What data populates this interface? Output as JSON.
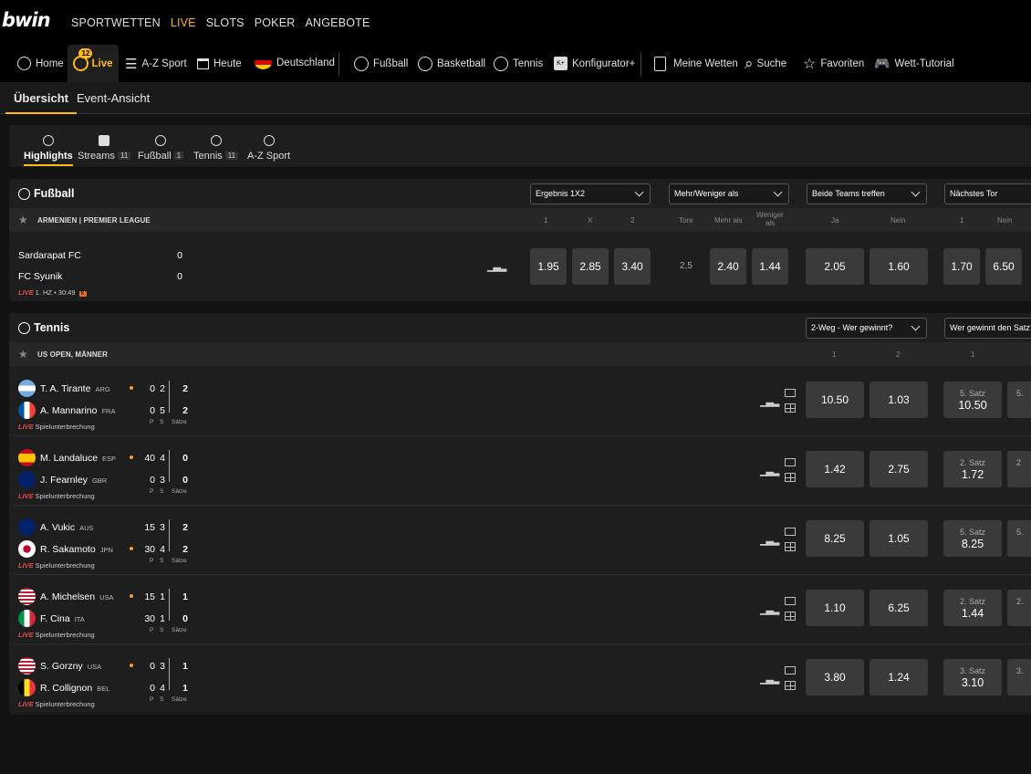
{
  "brand": "bwin",
  "topnav": [
    "SPORTWETTEN",
    "LIVE",
    "SLOTS",
    "POKER",
    "ANGEBOTE"
  ],
  "nav2": {
    "home": "Home",
    "live_count": "12",
    "live": "Live",
    "az": "A-Z Sport",
    "heute": "Heute",
    "land": "Deutschland",
    "fussball": "Fußball",
    "basketball": "Basketball",
    "tennis": "Tennis",
    "konf_icon": "K+",
    "konfigurator": "Konfigurator+",
    "meine": "Meine Wetten",
    "suche": "Suche",
    "favoriten": "Favoriten",
    "tutorial": "Wett-Tutorial"
  },
  "tabs": {
    "overview": "Übersicht",
    "event": "Event-Ansicht"
  },
  "chips": [
    {
      "label": "Highlights",
      "count": ""
    },
    {
      "label": "Streams",
      "count": "11"
    },
    {
      "label": "Fußball",
      "count": "1"
    },
    {
      "label": "Tennis",
      "count": "11"
    },
    {
      "label": "A-Z Sport",
      "count": ""
    }
  ],
  "football": {
    "title": "Fußball",
    "dropdowns": [
      "Ergebnis 1X2",
      "Mehr/Weniger als",
      "Beide Teams treffen",
      "Nächstes Tor"
    ],
    "league": "ARMENIEN | PREMIER LEAGUE",
    "cols": {
      "c1": "1",
      "cx": "X",
      "c2": "2",
      "tore": "Tore",
      "mehr": "Mehr als",
      "weniger": "Weniger als",
      "ja": "Ja",
      "nein": "Nein",
      "n1": "1",
      "nnein": "Nein"
    },
    "home": "Sardarapat FC",
    "home_score": "0",
    "away": "FC Syunik",
    "away_score": "0",
    "live": "LIVE",
    "status": "1. HZ • 30:49",
    "card": "K",
    "stat_icon": "bar-chart",
    "odds": {
      "o1": "1.95",
      "ox": "2.85",
      "o2": "3.40",
      "tore": "2,5",
      "mehr": "2.40",
      "weniger": "1.44",
      "ja": "2.05",
      "nein": "1.60",
      "n1": "1.70",
      "nn": "6.50"
    }
  },
  "tennis": {
    "title": "Tennis",
    "dropdowns": [
      "2-Weg - Wer gewinnt?",
      "Wer gewinnt den Satz?"
    ],
    "league": "US OPEN, MÄNNER",
    "cols": {
      "c1": "1",
      "c2": "2",
      "s1": "1"
    },
    "labels": {
      "p": "P",
      "s": "S",
      "saetze": "Sätze",
      "live": "LIVE"
    },
    "matches": [
      {
        "p1": "T. A. Tirante",
        "c1": "ARG",
        "p2": "A. Mannarino",
        "c2": "FRA",
        "serve": 1,
        "pt1": "0",
        "g1": "2",
        "s1": "2",
        "pt2": "0",
        "g2": "5",
        "s2": "2",
        "status": "Spielunterbrechung",
        "o1": "10.50",
        "o2": "1.03",
        "set_label": "5. Satz",
        "set_odd": "10.50",
        "cut": "5."
      },
      {
        "p1": "M. Landaluce",
        "c1": "ESP",
        "p2": "J. Fearnley",
        "c2": "GBR",
        "serve": 1,
        "pt1": "40",
        "g1": "4",
        "s1": "0",
        "pt2": "0",
        "g2": "3",
        "s2": "0",
        "status": "Spielunterbrechung",
        "o1": "1.42",
        "o2": "2.75",
        "set_label": "2. Satz",
        "set_odd": "1.72",
        "cut": "2"
      },
      {
        "p1": "A. Vukic",
        "c1": "AUS",
        "p2": "R. Sakamoto",
        "c2": "JPN",
        "serve": 2,
        "pt1": "15",
        "g1": "3",
        "s1": "2",
        "pt2": "30",
        "g2": "4",
        "s2": "2",
        "status": "Spielunterbrechung",
        "o1": "8.25",
        "o2": "1.05",
        "set_label": "5. Satz",
        "set_odd": "8.25",
        "cut": "5."
      },
      {
        "p1": "A. Michelsen",
        "c1": "USA",
        "p2": "F. Cina",
        "c2": "ITA",
        "serve": 1,
        "pt1": "15",
        "g1": "1",
        "s1": "1",
        "pt2": "30",
        "g2": "1",
        "s2": "0",
        "status": "Spielunterbrechung",
        "o1": "1.10",
        "o2": "6.25",
        "set_label": "2. Satz",
        "set_odd": "1.44",
        "cut": "2."
      },
      {
        "p1": "S. Gorzny",
        "c1": "USA",
        "p2": "R. Collignon",
        "c2": "BEL",
        "serve": 1,
        "pt1": "0",
        "g1": "3",
        "s1": "1",
        "pt2": "0",
        "g2": "4",
        "s2": "1",
        "status": "Spielunterbrechung",
        "o1": "3.80",
        "o2": "1.24",
        "set_label": "3. Satz",
        "set_odd": "3.10",
        "cut": "3."
      }
    ]
  },
  "colors": {
    "accent": "#ffb81c",
    "live": "#e34a4a",
    "odd_bg": "#3a3a3a"
  }
}
